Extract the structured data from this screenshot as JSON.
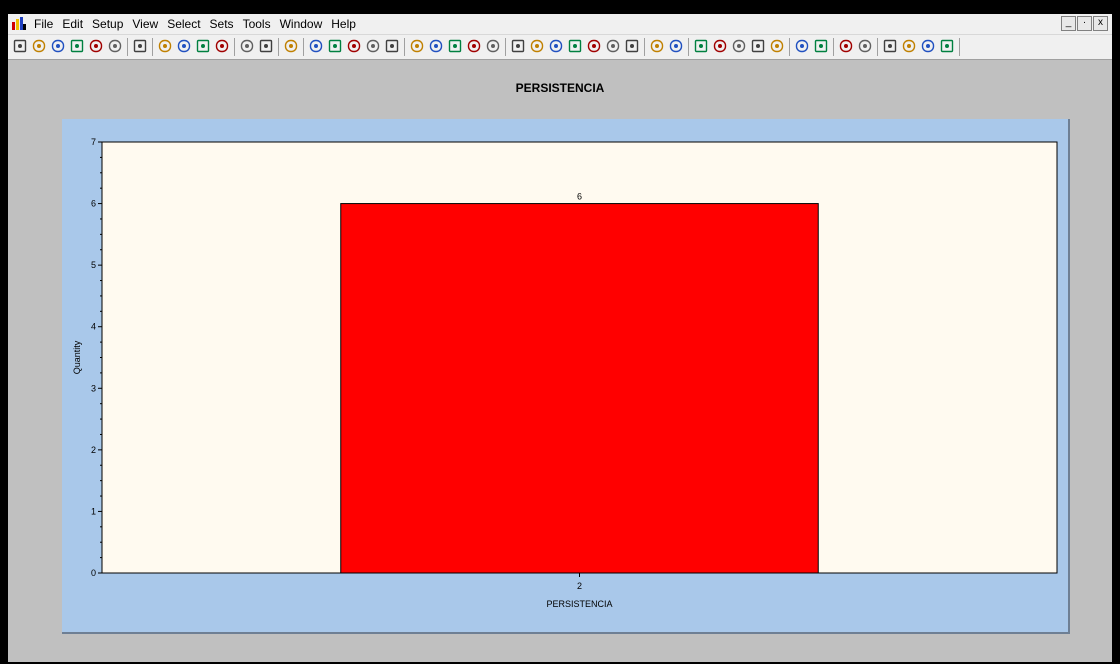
{
  "menubar": {
    "items": [
      "File",
      "Edit",
      "Setup",
      "View",
      "Select",
      "Sets",
      "Tools",
      "Window",
      "Help"
    ]
  },
  "window_controls": [
    "_",
    "·",
    "x"
  ],
  "toolbar": {
    "icons": [
      "new-file-icon",
      "open-folder-icon",
      "dropdown-arrow-icon",
      "save-icon",
      "print-preview-icon",
      "print-icon",
      "undo-icon",
      "cut-icon",
      "copy-icon",
      "paste-icon",
      "table-icon",
      "tool-icon",
      "chart-wizard-icon",
      "data-icon",
      "smiley-icon",
      "face-icon",
      "globe-icon",
      "target-icon",
      "compass-icon",
      "graph-icon",
      "shape-icon",
      "circle-icon",
      "pie-icon",
      "layers-icon",
      "empty-set-icon",
      "flask-icon",
      "triangle-icon",
      "sphere-icon",
      "crosshair-icon",
      "waves-icon",
      "disk-icon",
      "pen-icon",
      "bar-chart-icon",
      "tree-icon",
      "tree2-icon",
      "arrow-right-icon",
      "arrow-right2-icon",
      "grid-icon",
      "color-bar-icon",
      "list-icon",
      "clock-icon",
      "clock2-icon",
      "dial-icon",
      "dial2-icon",
      "dial3-icon",
      "dial4-icon"
    ]
  },
  "chart_data": {
    "type": "bar",
    "title": "PERSISTENCIA",
    "xlabel": "PERSISTENCIA",
    "ylabel": "Quantity",
    "categories": [
      "2"
    ],
    "values": [
      6
    ],
    "data_labels": [
      "6"
    ],
    "ylim": [
      0,
      7
    ],
    "yticks": [
      "0",
      "1",
      "2",
      "3",
      "4",
      "5",
      "6",
      "7"
    ],
    "bar_color": "#ff0000",
    "plot_background": "#fffaf0",
    "panel_background": "#a9c8ea"
  }
}
